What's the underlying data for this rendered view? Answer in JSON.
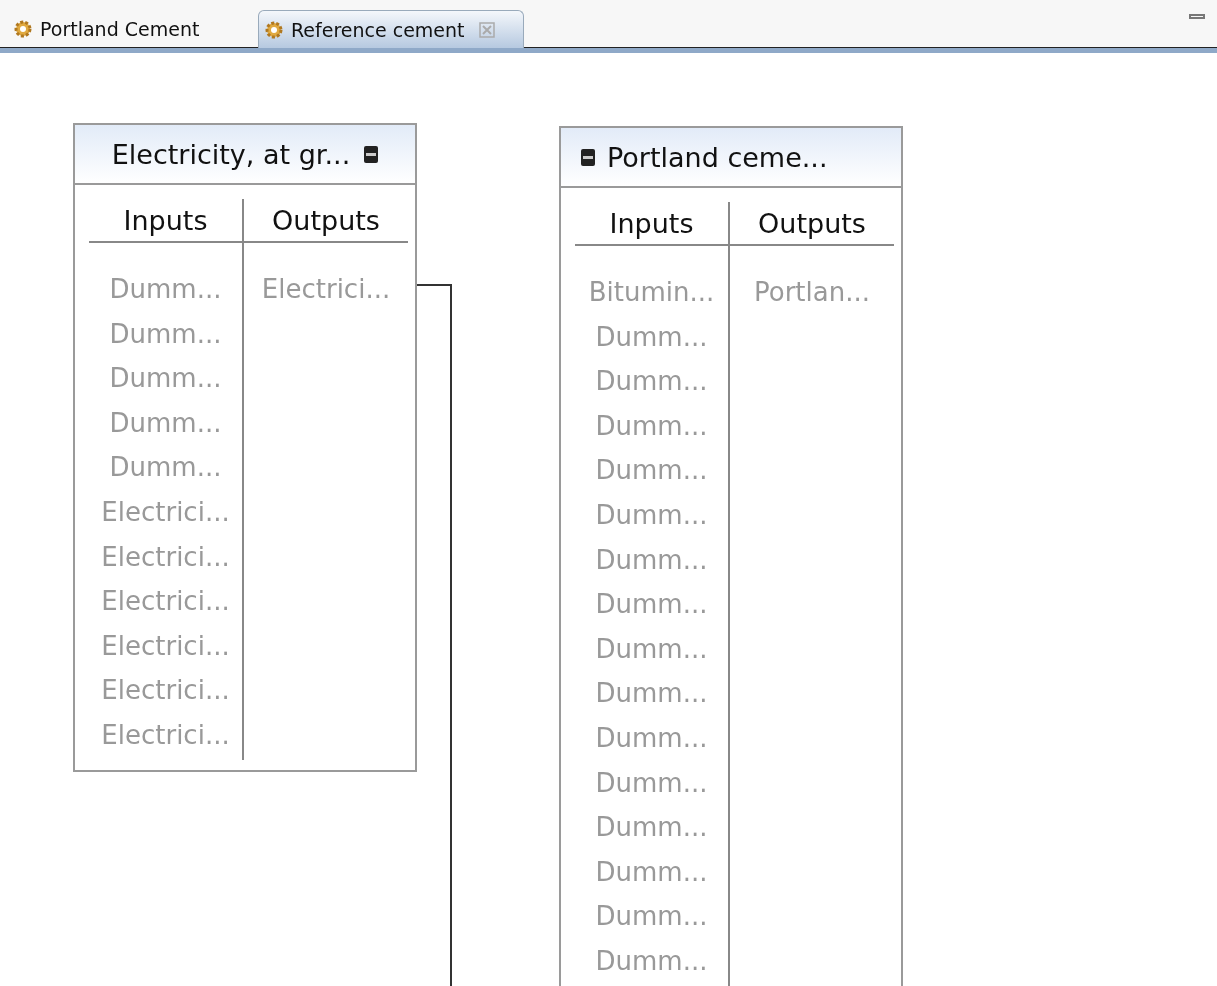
{
  "tabs": [
    {
      "label": "Portland Cement",
      "selected": false,
      "closable": false
    },
    {
      "label": "Reference cement",
      "selected": true,
      "closable": true
    }
  ],
  "nodes": [
    {
      "title": "Electricity, at gr...",
      "icon_first": false,
      "inputs_label": "Inputs",
      "outputs_label": "Outputs",
      "inputs": [
        "Dumm...",
        "Dumm...",
        "Dumm...",
        "Dumm...",
        "Dumm...",
        "Electrici...",
        "Electrici...",
        "Electrici...",
        "Electrici...",
        "Electrici...",
        "Electrici..."
      ],
      "outputs": [
        "Electrici..."
      ]
    },
    {
      "title": "Portland ceme...",
      "icon_first": true,
      "inputs_label": "Inputs",
      "outputs_label": "Outputs",
      "inputs": [
        "Bitumin...",
        "Dumm...",
        "Dumm...",
        "Dumm...",
        "Dumm...",
        "Dumm...",
        "Dumm...",
        "Dumm...",
        "Dumm...",
        "Dumm...",
        "Dumm...",
        "Dumm...",
        "Dumm...",
        "Dumm...",
        "Dumm...",
        "Dumm..."
      ],
      "outputs": [
        "Portlan..."
      ]
    }
  ]
}
